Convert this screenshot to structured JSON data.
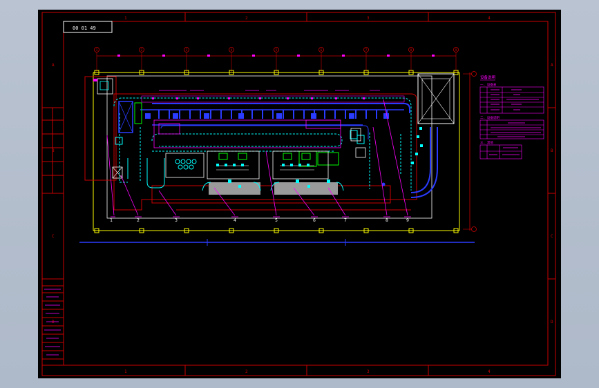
{
  "drawing": {
    "sheet_code": "00 01 49",
    "zone_labels": {
      "top": [
        "1",
        "2",
        "3",
        "4"
      ],
      "left": [
        "A",
        "B",
        "C",
        "D"
      ]
    },
    "grid_bubbles": [
      "1",
      "2",
      "3",
      "4",
      "5",
      "6",
      "7",
      "8",
      "9"
    ],
    "callout_numbers": [
      "1",
      "2",
      "3",
      "4",
      "5",
      "6",
      "7",
      "8",
      "9"
    ]
  },
  "legend": {
    "heading": "设备说明",
    "sub_heading_1": "一. 设备表",
    "sub_heading_2": "二. 设备说明",
    "sub_heading_3": "三. 其他"
  },
  "colors": {
    "frame": "#cc0000",
    "annotation": "#ff00ff",
    "equipment": "#00ffff",
    "conveyor": "#2a3cff",
    "axis": "#ffff00",
    "guide": "#ffffff",
    "green": "#00ff00"
  }
}
